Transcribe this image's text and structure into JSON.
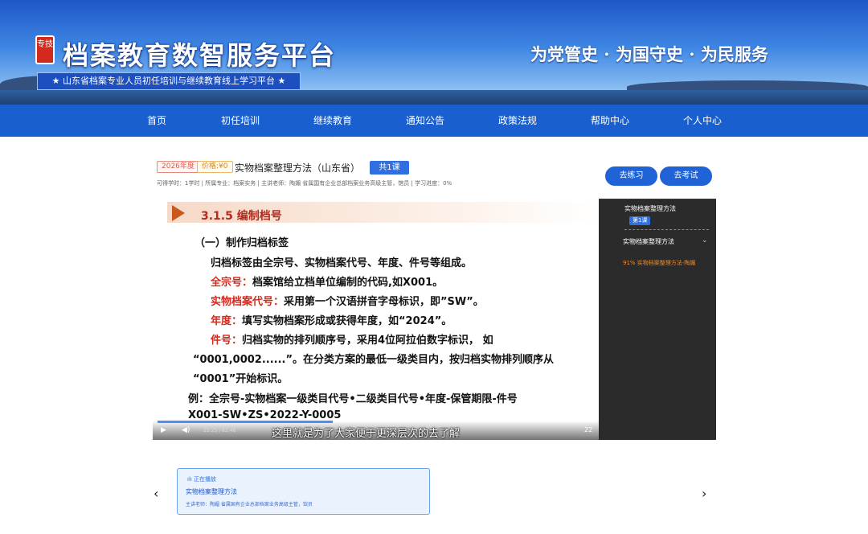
{
  "header": {
    "logo_seal": "专技",
    "site_title": "档案教育数智服务平台",
    "subtitle": "★  山东省档案专业人员初任培训与继续教育线上学习平台  ★",
    "slogan": "为党管史 · 为国守史 · 为民服务"
  },
  "nav": {
    "items": [
      "首页",
      "初任培训",
      "继续教育",
      "通知公告",
      "政策法规",
      "帮助中心",
      "个人中心"
    ]
  },
  "course": {
    "year_tag": "2026年度",
    "price_tag": "价格:¥0",
    "title": "实物档案整理方法（山东省）",
    "lessons_badge": "共1课",
    "meta": "可得学时：1学时 | 所属专业：档案实务 | 主讲老师：陶媚 省属国有企业总部档案业务高级主管，馆员 | 学习进度：0%",
    "practice_button": "去练习",
    "exam_button": "去考试"
  },
  "slide": {
    "heading": "3.1.5   编制档号",
    "line1": "（一）制作归档标签",
    "line2": "归档标签由全宗号、实物档案代号、年度、件号等组成。",
    "line3_label": "全宗号：",
    "line3_text": "档案馆给立档单位编制的代码,如X001。",
    "line4_label": "实物档案代号：",
    "line4_text": "采用第一个汉语拼音字母标识，即”SW”。",
    "line5_label": "年度：",
    "line5_text": "填写实物档案形成或获得年度，如“2024”。",
    "line6_label": "件号：",
    "line6_text": "归档实物的排列顺序号，采用4位阿拉伯数字标识，    如",
    "line7": "“0001,0002......”。在分类方案的最低一级类目内，按归档实物排列顺序从",
    "line8": "“0001”开始标识。",
    "line9": "例：全宗号-实物档案一级类目代号•二级类目代号•年度-保管期限-件号",
    "line10": "X001-SW•ZS•2022-Y-0005"
  },
  "player": {
    "time": "25:25 / 62:48",
    "subtitle": "这里就是为了大家便于更深层次的去了解",
    "speed": "22",
    "progress": 0.4
  },
  "playlist": {
    "header": "实物档案整理方法",
    "badge": "第1课",
    "chapter": "实物档案整理方法",
    "item": "91%  实物档案整理方法-陶媚"
  },
  "now_playing": {
    "status": "正在播放",
    "title": "实物档案整理方法",
    "teacher": "主讲老师：陶媚 省属国有企业总部档案业务高级主管，馆员"
  },
  "colors": {
    "primary": "#1a5fcf",
    "accent_red": "#d42a1d",
    "progress_orange": "#f08a24"
  }
}
